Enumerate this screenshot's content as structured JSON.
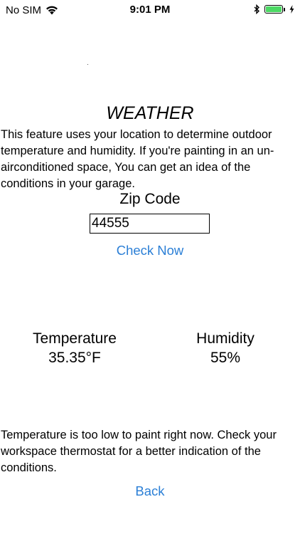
{
  "status_bar": {
    "carrier": "No SIM",
    "time": "9:01 PM",
    "icons": [
      "wifi-icon",
      "bluetooth-icon",
      "battery-icon",
      "charging-bolt-icon"
    ],
    "battery_color": "#4cd964",
    "battery_level": 1.0
  },
  "page": {
    "title": "WEATHER",
    "intro": "This feature uses your location to determine outdoor temperature and humidity.  If you're painting in an un-airconditioned space, You can get an idea of the conditions in your garage.",
    "zip_label": "Zip Code",
    "zip_value": "44555",
    "check_now": "Check Now",
    "temperature_label": "Temperature",
    "temperature_value": "35.35°F",
    "humidity_label": "Humidity",
    "humidity_value": "55%",
    "message": "Temperature is too low to paint right now.  Check your workspace thermostat for a better indication of the conditions.",
    "back": "Back",
    "link_color": "#2b7fd6"
  }
}
